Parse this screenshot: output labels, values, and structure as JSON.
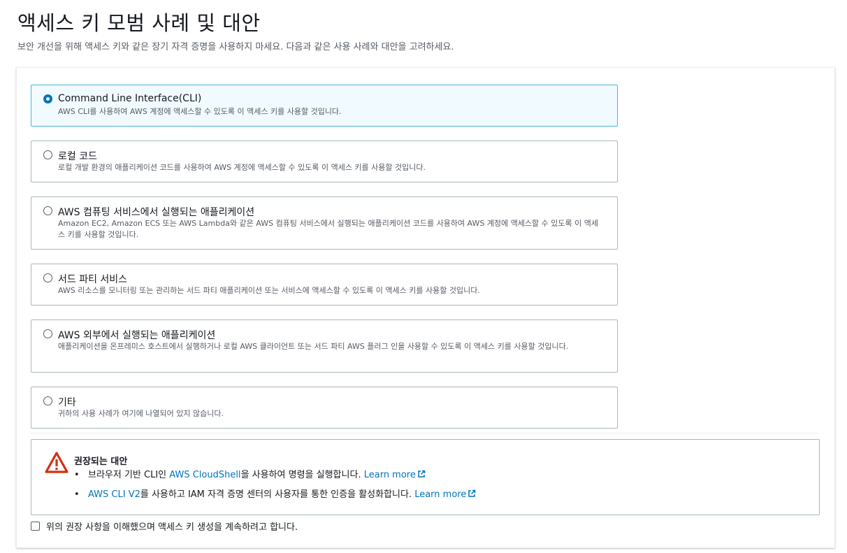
{
  "page": {
    "title": "액세스 키 모범 사례 및 대안",
    "description": "보안 개선을 위해 액세스 키와 같은 장기 자격 증명을 사용하지 마세요. 다음과 같은 사용 사례와 대안을 고려하세요."
  },
  "use_cases": [
    {
      "title": "Command Line Interface(CLI)",
      "description": "AWS CLI를 사용하여 AWS 계정에 액세스할 수 있도록 이 액세스 키를 사용할 것입니다.",
      "selected": true
    },
    {
      "title": "로컬 코드",
      "description": "로컬 개발 환경의 애플리케이션 코드를 사용하여 AWS 계정에 액세스할 수 있도록 이 액세스 키를 사용할 것입니다.",
      "selected": false
    },
    {
      "title": "AWS 컴퓨팅 서비스에서 실행되는 애플리케이션",
      "description": "Amazon EC2, Amazon ECS 또는 AWS Lambda와 같은 AWS 컴퓨팅 서비스에서 실행되는 애플리케이션 코드를 사용하여 AWS 계정에 액세스할 수 있도록 이 액세스 키를 사용할 것입니다.",
      "selected": false
    },
    {
      "title": "서드 파티 서비스",
      "description": "AWS 리소스를 모니터링 또는 관리하는 서드 파티 애플리케이션 또는 서비스에 액세스할 수 있도록 이 액세스 키를 사용할 것입니다.",
      "selected": false
    },
    {
      "title": "AWS 외부에서 실행되는 애플리케이션",
      "description": "애플리케이션을 온프레미스 호스트에서 실행하거나 로컬 AWS 클라이언트 또는 서드 파티 AWS 플러그 인을 사용할 수 있도록 이 액세스 키를 사용할 것입니다.",
      "selected": false
    },
    {
      "title": "기타",
      "description": "귀하의 사용 사례가 여기에 나열되어 있지 않습니다.",
      "selected": false
    }
  ],
  "alert": {
    "title": "권장되는 대안",
    "item1": {
      "prefix": "브라우저 기반 CLI인 ",
      "link": "AWS CloudShell",
      "suffix": "을 사용하여 명령을 실행합니다. ",
      "learn_more": "Learn more"
    },
    "item2": {
      "link": "AWS CLI V2",
      "suffix": "를 사용하고 IAM 자격 증명 센터의 사용자를 통한 인증을 활성화합니다. ",
      "learn_more": "Learn more"
    }
  },
  "acknowledgement": {
    "label": "위의 권장 사항을 이해했으며 액세스 키 생성을 계속하려고 합니다.",
    "checked": false
  },
  "colors": {
    "link": "#0073bb",
    "selected_border": "#44b9d6",
    "selected_bg": "#f1faff",
    "warning_icon": "#d13212"
  }
}
